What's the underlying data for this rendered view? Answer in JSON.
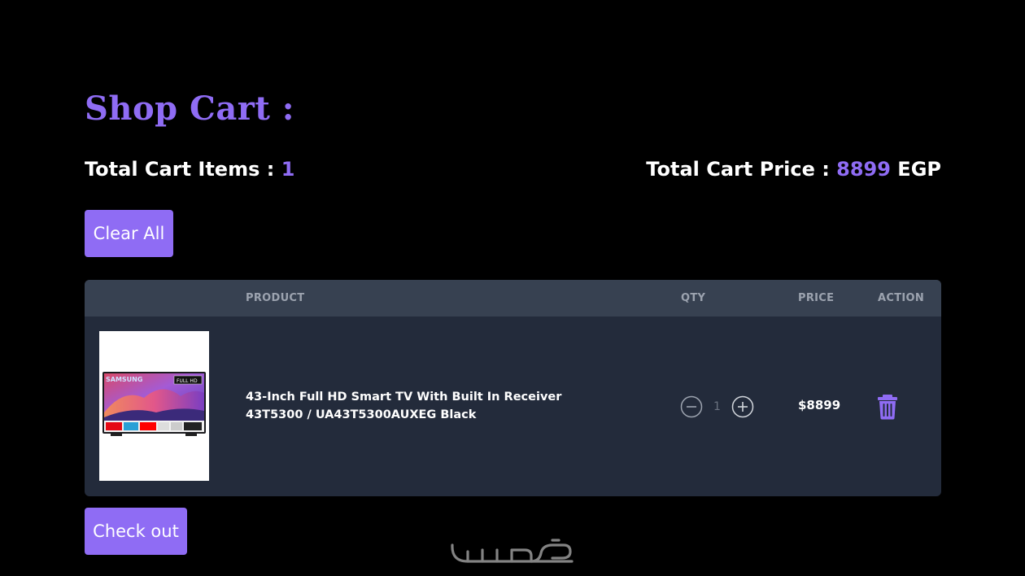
{
  "page": {
    "title": "Shop Cart :"
  },
  "summary": {
    "items_label": "Total Cart Items : ",
    "items_count": "1",
    "price_label": "Total Cart Price : ",
    "price_value": "8899",
    "currency": " EGP"
  },
  "buttons": {
    "clear_all": "Clear All",
    "checkout": "Check out"
  },
  "table": {
    "headers": {
      "product": "PRODUCT",
      "qty": "QTY",
      "price": "PRICE",
      "action": "ACTION"
    },
    "rows": [
      {
        "image_alt": "samsung-tv-product-image",
        "image_brand_text": "SAMSUNG",
        "image_badge_text": "FULL HD",
        "name": "43-Inch Full HD Smart TV With Built In Receiver 43T5300 / UA43T5300AUXEG Black",
        "qty": "1",
        "price": "$8899",
        "icons": {
          "decrease": "minus-circle-icon",
          "increase": "plus-circle-icon",
          "delete": "trash-icon"
        }
      }
    ]
  },
  "watermark": {
    "text": "خمسات"
  },
  "colors": {
    "accent": "#8f6cf4",
    "background": "#000000",
    "table_header": "#374151",
    "table_body": "#232b3b",
    "muted_text": "#9ca3af"
  }
}
